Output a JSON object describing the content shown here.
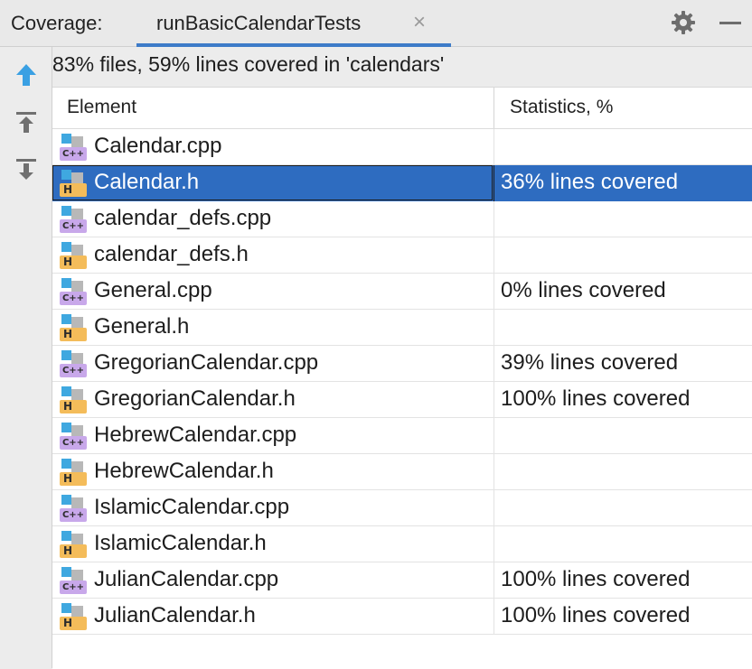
{
  "tabbar": {
    "prefix": "Coverage:",
    "active_tab": "runBasicCalendarTests",
    "close_glyph": "×"
  },
  "summary": "83% files, 59% lines covered in 'calendars'",
  "table": {
    "columns": [
      "Element",
      "Statistics, %"
    ],
    "rows": [
      {
        "name": "Calendar.cpp",
        "type": "cpp",
        "stat": ""
      },
      {
        "name": "Calendar.h",
        "type": "h",
        "stat": "36% lines covered",
        "selected": true
      },
      {
        "name": "calendar_defs.cpp",
        "type": "cpp",
        "stat": ""
      },
      {
        "name": "calendar_defs.h",
        "type": "h",
        "stat": ""
      },
      {
        "name": "General.cpp",
        "type": "cpp",
        "stat": "0% lines covered"
      },
      {
        "name": "General.h",
        "type": "h",
        "stat": ""
      },
      {
        "name": "GregorianCalendar.cpp",
        "type": "cpp",
        "stat": "39% lines covered"
      },
      {
        "name": "GregorianCalendar.h",
        "type": "h",
        "stat": "100% lines covered"
      },
      {
        "name": "HebrewCalendar.cpp",
        "type": "cpp",
        "stat": ""
      },
      {
        "name": "HebrewCalendar.h",
        "type": "h",
        "stat": ""
      },
      {
        "name": "IslamicCalendar.cpp",
        "type": "cpp",
        "stat": ""
      },
      {
        "name": "IslamicCalendar.h",
        "type": "h",
        "stat": ""
      },
      {
        "name": "JulianCalendar.cpp",
        "type": "cpp",
        "stat": "100% lines covered"
      },
      {
        "name": "JulianCalendar.h",
        "type": "h",
        "stat": "100% lines covered"
      }
    ]
  },
  "badges": {
    "cpp": "C++",
    "h": "H"
  },
  "icons": {
    "toolbar": [
      "arrow-up-icon",
      "export-icon",
      "import-icon"
    ],
    "settings": "gear-icon",
    "minimize": "minimize-icon"
  },
  "colors": {
    "accent": "#3d7bc8",
    "selection": "#2e6cc0",
    "cpp_badge": "#c8a8ea",
    "h_badge": "#f4bc5a",
    "file_icon_blue": "#3fa8e0"
  }
}
